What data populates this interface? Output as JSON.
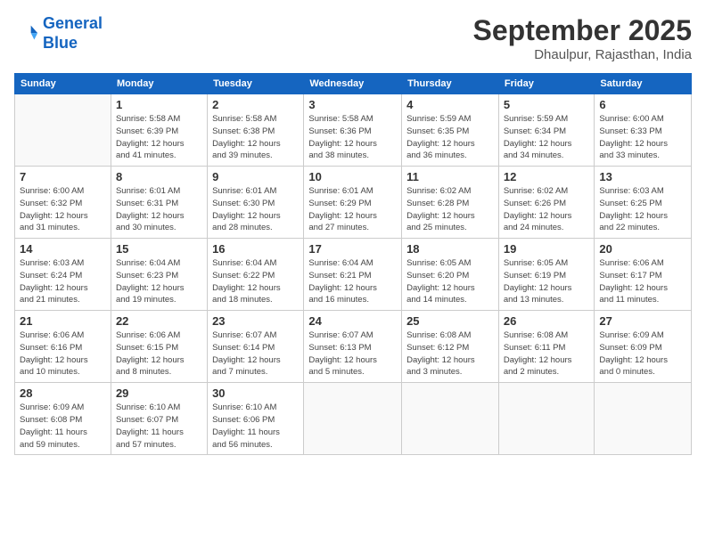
{
  "logo": {
    "line1": "General",
    "line2": "Blue"
  },
  "title": "September 2025",
  "subtitle": "Dhaulpur, Rajasthan, India",
  "days_header": [
    "Sunday",
    "Monday",
    "Tuesday",
    "Wednesday",
    "Thursday",
    "Friday",
    "Saturday"
  ],
  "weeks": [
    [
      {
        "day": "",
        "detail": ""
      },
      {
        "day": "1",
        "detail": "Sunrise: 5:58 AM\nSunset: 6:39 PM\nDaylight: 12 hours\nand 41 minutes."
      },
      {
        "day": "2",
        "detail": "Sunrise: 5:58 AM\nSunset: 6:38 PM\nDaylight: 12 hours\nand 39 minutes."
      },
      {
        "day": "3",
        "detail": "Sunrise: 5:58 AM\nSunset: 6:36 PM\nDaylight: 12 hours\nand 38 minutes."
      },
      {
        "day": "4",
        "detail": "Sunrise: 5:59 AM\nSunset: 6:35 PM\nDaylight: 12 hours\nand 36 minutes."
      },
      {
        "day": "5",
        "detail": "Sunrise: 5:59 AM\nSunset: 6:34 PM\nDaylight: 12 hours\nand 34 minutes."
      },
      {
        "day": "6",
        "detail": "Sunrise: 6:00 AM\nSunset: 6:33 PM\nDaylight: 12 hours\nand 33 minutes."
      }
    ],
    [
      {
        "day": "7",
        "detail": "Sunrise: 6:00 AM\nSunset: 6:32 PM\nDaylight: 12 hours\nand 31 minutes."
      },
      {
        "day": "8",
        "detail": "Sunrise: 6:01 AM\nSunset: 6:31 PM\nDaylight: 12 hours\nand 30 minutes."
      },
      {
        "day": "9",
        "detail": "Sunrise: 6:01 AM\nSunset: 6:30 PM\nDaylight: 12 hours\nand 28 minutes."
      },
      {
        "day": "10",
        "detail": "Sunrise: 6:01 AM\nSunset: 6:29 PM\nDaylight: 12 hours\nand 27 minutes."
      },
      {
        "day": "11",
        "detail": "Sunrise: 6:02 AM\nSunset: 6:28 PM\nDaylight: 12 hours\nand 25 minutes."
      },
      {
        "day": "12",
        "detail": "Sunrise: 6:02 AM\nSunset: 6:26 PM\nDaylight: 12 hours\nand 24 minutes."
      },
      {
        "day": "13",
        "detail": "Sunrise: 6:03 AM\nSunset: 6:25 PM\nDaylight: 12 hours\nand 22 minutes."
      }
    ],
    [
      {
        "day": "14",
        "detail": "Sunrise: 6:03 AM\nSunset: 6:24 PM\nDaylight: 12 hours\nand 21 minutes."
      },
      {
        "day": "15",
        "detail": "Sunrise: 6:04 AM\nSunset: 6:23 PM\nDaylight: 12 hours\nand 19 minutes."
      },
      {
        "day": "16",
        "detail": "Sunrise: 6:04 AM\nSunset: 6:22 PM\nDaylight: 12 hours\nand 18 minutes."
      },
      {
        "day": "17",
        "detail": "Sunrise: 6:04 AM\nSunset: 6:21 PM\nDaylight: 12 hours\nand 16 minutes."
      },
      {
        "day": "18",
        "detail": "Sunrise: 6:05 AM\nSunset: 6:20 PM\nDaylight: 12 hours\nand 14 minutes."
      },
      {
        "day": "19",
        "detail": "Sunrise: 6:05 AM\nSunset: 6:19 PM\nDaylight: 12 hours\nand 13 minutes."
      },
      {
        "day": "20",
        "detail": "Sunrise: 6:06 AM\nSunset: 6:17 PM\nDaylight: 12 hours\nand 11 minutes."
      }
    ],
    [
      {
        "day": "21",
        "detail": "Sunrise: 6:06 AM\nSunset: 6:16 PM\nDaylight: 12 hours\nand 10 minutes."
      },
      {
        "day": "22",
        "detail": "Sunrise: 6:06 AM\nSunset: 6:15 PM\nDaylight: 12 hours\nand 8 minutes."
      },
      {
        "day": "23",
        "detail": "Sunrise: 6:07 AM\nSunset: 6:14 PM\nDaylight: 12 hours\nand 7 minutes."
      },
      {
        "day": "24",
        "detail": "Sunrise: 6:07 AM\nSunset: 6:13 PM\nDaylight: 12 hours\nand 5 minutes."
      },
      {
        "day": "25",
        "detail": "Sunrise: 6:08 AM\nSunset: 6:12 PM\nDaylight: 12 hours\nand 3 minutes."
      },
      {
        "day": "26",
        "detail": "Sunrise: 6:08 AM\nSunset: 6:11 PM\nDaylight: 12 hours\nand 2 minutes."
      },
      {
        "day": "27",
        "detail": "Sunrise: 6:09 AM\nSunset: 6:09 PM\nDaylight: 12 hours\nand 0 minutes."
      }
    ],
    [
      {
        "day": "28",
        "detail": "Sunrise: 6:09 AM\nSunset: 6:08 PM\nDaylight: 11 hours\nand 59 minutes."
      },
      {
        "day": "29",
        "detail": "Sunrise: 6:10 AM\nSunset: 6:07 PM\nDaylight: 11 hours\nand 57 minutes."
      },
      {
        "day": "30",
        "detail": "Sunrise: 6:10 AM\nSunset: 6:06 PM\nDaylight: 11 hours\nand 56 minutes."
      },
      {
        "day": "",
        "detail": ""
      },
      {
        "day": "",
        "detail": ""
      },
      {
        "day": "",
        "detail": ""
      },
      {
        "day": "",
        "detail": ""
      }
    ]
  ]
}
